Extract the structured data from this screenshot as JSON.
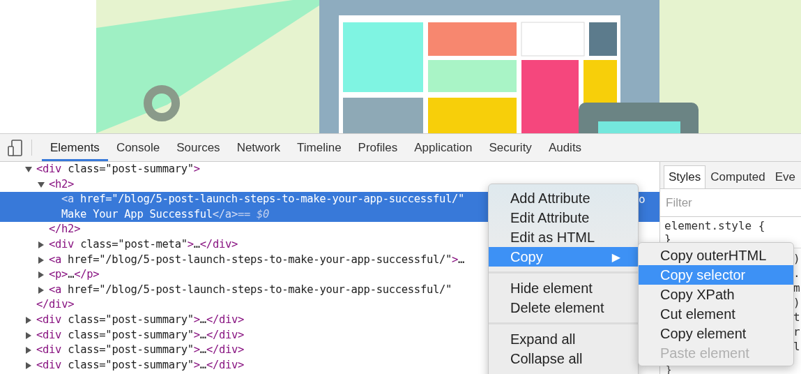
{
  "toolbar": {
    "tabs": [
      {
        "label": "Elements",
        "selected": true
      },
      {
        "label": "Console",
        "selected": false
      },
      {
        "label": "Sources",
        "selected": false
      },
      {
        "label": "Network",
        "selected": false
      },
      {
        "label": "Timeline",
        "selected": false
      },
      {
        "label": "Profiles",
        "selected": false
      },
      {
        "label": "Application",
        "selected": false
      },
      {
        "label": "Security",
        "selected": false
      },
      {
        "label": "Audits",
        "selected": false
      }
    ]
  },
  "dom_tree": [
    {
      "open": "<div class=\"post-summary\">",
      "expanded": true,
      "selected": false,
      "close": "</div>",
      "children": [
        {
          "open": "<h2>",
          "expanded": true,
          "selected": false,
          "close": "</h2>",
          "children": [
            {
              "open": "<a href=\"/blog/5-post-launch-steps-to-make-your-app-successful/\"\nMake Your App Successful</a>",
              "marker": "== $0",
              "hidden_tail": "o",
              "selected": true
            }
          ]
        },
        {
          "open": "<div class=\"post-meta\">…</div>",
          "expanded": false,
          "selected": false
        },
        {
          "open": "<a href=\"/blog/5-post-launch-steps-to-make-your-app-successful/\">…",
          "expanded": false,
          "selected": false
        },
        {
          "open": "<p>…</p>",
          "expanded": false,
          "selected": false
        },
        {
          "open": "<a href=\"/blog/5-post-launch-steps-to-make-your-app-successful/\"",
          "expanded": false,
          "selected": false
        }
      ]
    },
    {
      "open": "<div class=\"post-summary\">…</div>",
      "expanded": false,
      "selected": false
    },
    {
      "open": "<div class=\"post-summary\">…</div>",
      "expanded": false,
      "selected": false
    },
    {
      "open": "<div class=\"post-summary\">…</div>",
      "expanded": false,
      "selected": false
    },
    {
      "open": "<div class=\"post-summary\">…</div>",
      "expanded": false,
      "selected": false
    }
  ],
  "sidebar": {
    "tabs": [
      {
        "label": "Styles",
        "selected": true
      },
      {
        "label": "Computed",
        "selected": false
      },
      {
        "label": "Eve",
        "selected": false
      }
    ],
    "filter": {
      "placeholder": "Filter"
    },
    "rule": {
      "selector": "element.style {",
      "close": "}"
    },
    "fragments": [
      ")",
      ".",
      "m",
      ")",
      "t",
      "r",
      "l"
    ],
    "trailing_brace": "}"
  },
  "context_menu": {
    "items": [
      {
        "kind": "item",
        "label": "Add Attribute",
        "selected": false
      },
      {
        "kind": "item",
        "label": "Edit Attribute",
        "selected": false
      },
      {
        "kind": "item",
        "label": "Edit as HTML",
        "selected": false
      },
      {
        "kind": "submenu",
        "label": "Copy",
        "selected": true,
        "arrow": "▶"
      },
      {
        "kind": "separator"
      },
      {
        "kind": "item",
        "label": "Hide element",
        "selected": false
      },
      {
        "kind": "item",
        "label": "Delete element",
        "selected": false
      },
      {
        "kind": "separator"
      },
      {
        "kind": "item",
        "label": "Expand all",
        "selected": false
      },
      {
        "kind": "item",
        "label": "Collapse all",
        "selected": false
      }
    ]
  },
  "submenu": {
    "items": [
      {
        "label": "Copy outerHTML",
        "selected": false,
        "disabled": false
      },
      {
        "label": "Copy selector",
        "selected": true,
        "disabled": false
      },
      {
        "label": "Copy XPath",
        "selected": false,
        "disabled": false
      },
      {
        "label": "Cut element",
        "selected": false,
        "disabled": false
      },
      {
        "label": "Copy element",
        "selected": false,
        "disabled": false
      },
      {
        "label": "Paste element",
        "selected": false,
        "disabled": true
      }
    ]
  }
}
